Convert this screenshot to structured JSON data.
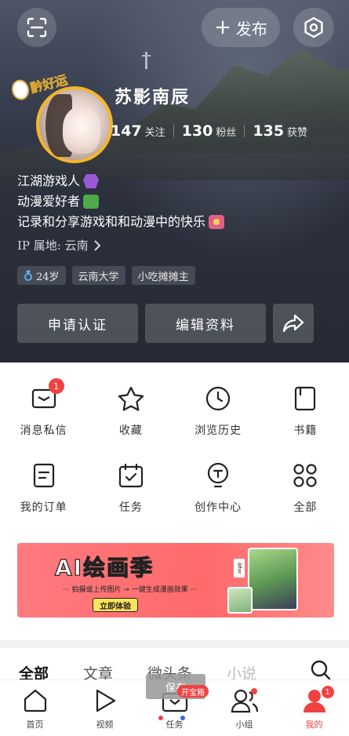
{
  "header": {
    "publish_label": "发布",
    "scan_icon": "scan-icon",
    "settings_icon": "settings-hexagon-icon"
  },
  "profile": {
    "username": "苏影南辰",
    "avatar_sticker": "黔好运",
    "stats": [
      {
        "num": "147",
        "label": "关注"
      },
      {
        "num": "130",
        "label": "粉丝"
      },
      {
        "num": "135",
        "label": "获赞"
      }
    ],
    "bio": [
      {
        "text": "江湖游戏人",
        "emoji": "alien-icon"
      },
      {
        "text": "动漫爱好者",
        "emoji": "dragon-icon"
      },
      {
        "text": "记录和分享游戏和和动漫中的快乐",
        "emoji": "bouquet-icon"
      }
    ],
    "ip_location": "IP 属地: 云南",
    "tags": [
      {
        "text": "24岁",
        "icon": "male-icon"
      },
      {
        "text": "云南大学"
      },
      {
        "text": "小吃摊摊主"
      }
    ],
    "buttons": {
      "verify": "申请认证",
      "edit": "编辑资料"
    }
  },
  "grid": [
    {
      "label": "消息私信",
      "icon": "message-icon",
      "badge": "1"
    },
    {
      "label": "收藏",
      "icon": "star-icon"
    },
    {
      "label": "浏览历史",
      "icon": "clock-icon"
    },
    {
      "label": "书籍",
      "icon": "book-icon"
    },
    {
      "label": "我的订单",
      "icon": "order-icon"
    },
    {
      "label": "任务",
      "icon": "task-icon"
    },
    {
      "label": "创作中心",
      "icon": "bulb-icon"
    },
    {
      "label": "全部",
      "icon": "grid-icon"
    }
  ],
  "banner": {
    "title": "AI绘画季",
    "subtitle": "··· 拍摄或上传图片 → 一键生成漫画效果 ···",
    "cta": "立即体验",
    "after_label": "After"
  },
  "tabs": [
    {
      "label": "全部",
      "active": true
    },
    {
      "label": "文章"
    },
    {
      "label": "微头条"
    },
    {
      "label": "小说"
    }
  ],
  "toast": "保存",
  "treasure_tag": "开宝箱",
  "bottom_nav": [
    {
      "label": "首页",
      "icon": "home-icon"
    },
    {
      "label": "视频",
      "icon": "play-icon"
    },
    {
      "label": "任务",
      "icon": "treasure-box-icon"
    },
    {
      "label": "小组",
      "icon": "group-icon",
      "dot": true
    },
    {
      "label": "我的",
      "icon": "profile-icon",
      "badge": "1",
      "active": true
    }
  ],
  "colors": {
    "accent_red": "#f04142",
    "avatar_ring": "#f5b62a"
  }
}
